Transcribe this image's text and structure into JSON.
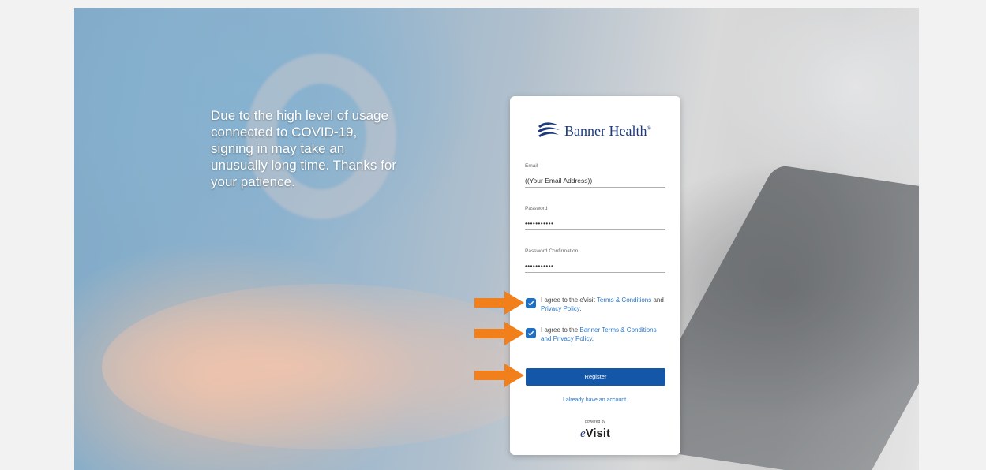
{
  "notice": {
    "text": "Due to the high level of usage connected to COVID-19, signing in may take an unusually long time. Thanks for your patience."
  },
  "brand": {
    "name": "Banner Health",
    "mark": "®",
    "logo_icon": "banner-wave-icon",
    "color": "#1d3a7a"
  },
  "form": {
    "email": {
      "label": "Email",
      "value": "((Your Email Address))"
    },
    "password": {
      "label": "Password",
      "value": "•••••••••••"
    },
    "password_confirmation": {
      "label": "Password Confirmation",
      "value": "•••••••••••"
    },
    "agreements": [
      {
        "checked": true,
        "prefix": "I agree to the eVisit ",
        "link1": "Terms & Conditions",
        "middle": " and ",
        "link2": "Privacy Policy",
        "suffix": "."
      },
      {
        "checked": true,
        "prefix": "I agree to the ",
        "link1": "Banner Terms & Conditions and Privacy Policy",
        "suffix": "."
      }
    ],
    "register_label": "Register",
    "login_link": "I already have an account.",
    "button_color": "#1457a8",
    "link_color": "#2a77c9"
  },
  "footer": {
    "powered_by": "powered by",
    "evisit_e": "e",
    "evisit_rest": "Visit"
  },
  "annotations": {
    "arrow_icon": "arrow-right-icon",
    "arrow_color": "#f07f1c"
  }
}
